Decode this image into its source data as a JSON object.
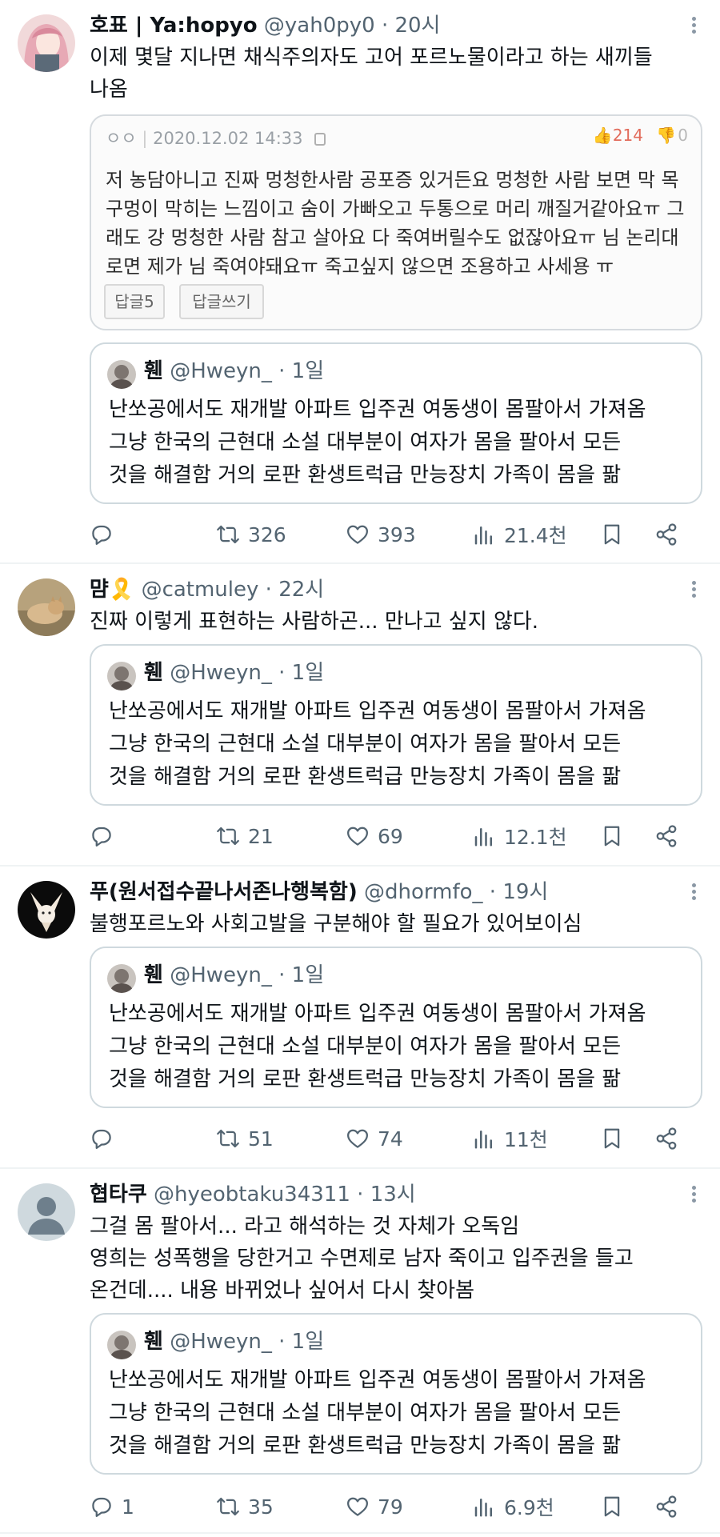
{
  "quoted": {
    "name": "휀",
    "handle": "@Hweyn_",
    "separator": "·",
    "time": "1일",
    "lines": [
      "난쏘공에서도 재개발 아파트 입주권 여동생이 몸팔아서 가져옴",
      "그냥 한국의 근현대 소설 대부분이 여자가 몸을 팔아서 모든",
      "것을 해결함 거의 로판 환생트럭급 만능장치 가족이 몸을 팖"
    ]
  },
  "tweets": [
    {
      "name": "호표 | Ya:hopyo",
      "handle": "@yah0py0",
      "separator": "·",
      "time": "20시",
      "lines": [
        "이제 몇달 지나면 채식주의자도 고어 포르노물이라고 하는 새끼들",
        "나옴"
      ],
      "image": {
        "top_label": "ㅇㅇ",
        "date": "2020.12.02 14:33",
        "upvotes": "214",
        "downvotes": "0",
        "lines": [
          "저 농담아니고 진짜 멍청한사람 공포증 있거든요 멍청한 사람 보면 막 목",
          "구멍이 막히는 느낌이고 숨이 가빠오고 두통으로 머리 깨질거같아요ㅠ 그",
          "래도 강 멍청한 사람 참고 살아요 다 죽여버릴수도 없잖아요ㅠ 님 논리대",
          "로면 제가 님 죽여야돼요ㅠ 죽고싶지 않으면 조용하고 사세용 ㅠ"
        ],
        "reply_count_label": "답글5",
        "write_reply_label": "답글쓰기"
      },
      "stats": {
        "replies": "",
        "retweets": "326",
        "likes": "393",
        "views": "21.4천"
      }
    },
    {
      "name": "먐🎗️",
      "handle": "@catmuley",
      "separator": "·",
      "time": "22시",
      "lines": [
        "진짜 이렇게 표현하는 사람하곤... 만나고 싶지 않다."
      ],
      "stats": {
        "replies": "",
        "retweets": "21",
        "likes": "69",
        "views": "12.1천"
      }
    },
    {
      "name": "푸(원서접수끝나서존나행복함)",
      "handle": "@dhormfo_",
      "separator": "·",
      "time": "19시",
      "lines": [
        "불행포르노와 사회고발을 구분해야 할 필요가 있어보이심"
      ],
      "stats": {
        "replies": "",
        "retweets": "51",
        "likes": "74",
        "views": "11천"
      }
    },
    {
      "name": "협타쿠",
      "handle": "@hyeobtaku34311",
      "separator": "·",
      "time": "13시",
      "lines": [
        "그걸 몸 팔아서... 라고 해석하는 것 자체가 오독임",
        "영희는 성폭행을 당한거고 수면제로 남자 죽이고 입주권을 들고",
        "온건데.... 내용 바뀌었나 싶어서 다시 찾아봄"
      ],
      "stats": {
        "replies": "1",
        "retweets": "35",
        "likes": "79",
        "views": "6.9천"
      }
    }
  ],
  "icons": {
    "reply": "reply-icon",
    "retweet": "retweet-icon",
    "like": "heart-icon",
    "views": "views-icon",
    "bookmark": "bookmark-icon",
    "share": "share-icon",
    "more": "more-icon"
  },
  "colors": {
    "text": "#0f1419",
    "secondary": "#536471",
    "border": "#cfd9de"
  }
}
